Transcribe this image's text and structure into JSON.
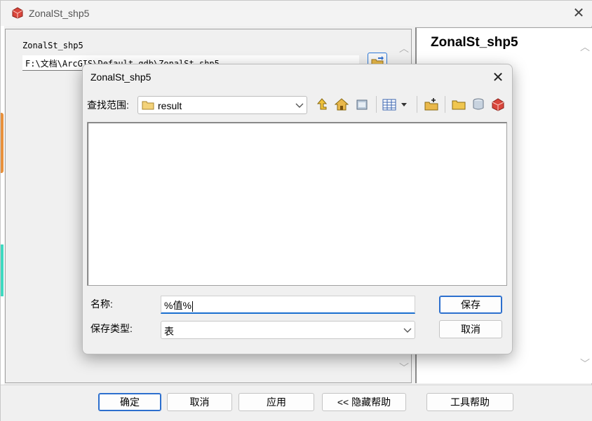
{
  "outer": {
    "title": "ZonalSt_shp5",
    "left_panel": {
      "label": "ZonalSt_shp5",
      "path_value": "F:\\文档\\ArcGIS\\Default.gdb\\ZonalSt_shp5"
    },
    "help_panel": {
      "title": "ZonalSt_shp5"
    },
    "buttons": {
      "ok": "确定",
      "cancel": "取消",
      "apply": "应用",
      "hide_help": "<< 隐藏帮助",
      "tool_help": "工具帮助"
    },
    "icons": {
      "app": "arcgis-toolbox-icon",
      "close": "close-icon",
      "browse": "open-folder-icon"
    }
  },
  "dialog": {
    "title": "ZonalSt_shp5",
    "look_in": {
      "label": "查找范围:",
      "value": "result"
    },
    "toolbar_icons": [
      "up-one-level-icon",
      "home-icon",
      "connect-folder-icon",
      "view-details-icon",
      "view-dropdown-icon",
      "new-item-icon",
      "new-folder-icon",
      "new-geodatabase-icon",
      "toolbox-icon"
    ],
    "name": {
      "label": "名称:",
      "value": "%值%"
    },
    "save_type": {
      "label": "保存类型:",
      "value": "表"
    },
    "buttons": {
      "save": "保存",
      "cancel": "取消"
    }
  },
  "colors": {
    "accent": "#2c6fce",
    "window_bg": "#f0f0f0",
    "panel_bg": "#ffffff"
  }
}
